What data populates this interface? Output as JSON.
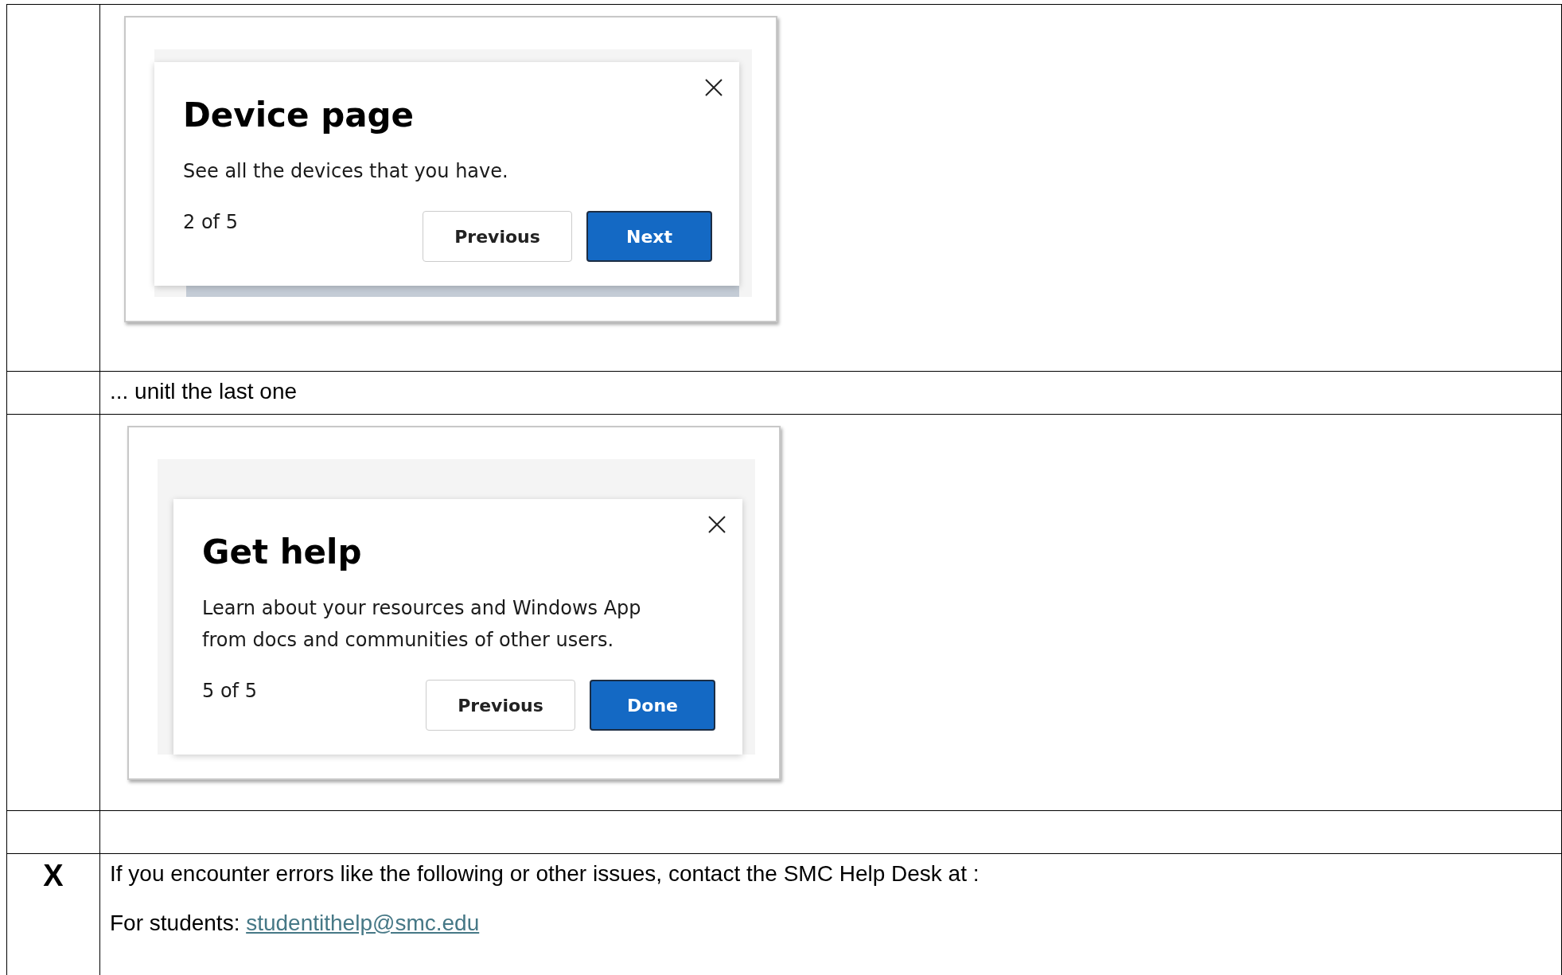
{
  "table": {
    "rows": [
      {
        "kind": "screenshot",
        "marker": "",
        "screenshot": {
          "page_strip": true,
          "title": "Device page",
          "body": "See all the devices that you have.",
          "step": "2 of 5",
          "buttons": [
            {
              "label": "Previous",
              "kind": "secondary"
            },
            {
              "label": "Next",
              "kind": "primary"
            }
          ]
        }
      },
      {
        "kind": "text",
        "marker": "",
        "text": "... unitl the last one"
      },
      {
        "kind": "screenshot",
        "marker": "",
        "screenshot": {
          "title": "Get help",
          "body": "Learn about your resources and Windows App from docs and communities of other users.",
          "step": "5 of 5",
          "buttons": [
            {
              "label": "Previous",
              "kind": "secondary"
            },
            {
              "label": "Done",
              "kind": "primary"
            }
          ]
        }
      },
      {
        "kind": "empty",
        "marker": ""
      },
      {
        "kind": "contact",
        "marker": "X",
        "text": "If you encounter errors like the following or other issues, contact the SMC Help Desk at :",
        "contact_label": "For students:",
        "contact_link": "studentithelp@smc.edu"
      }
    ]
  }
}
